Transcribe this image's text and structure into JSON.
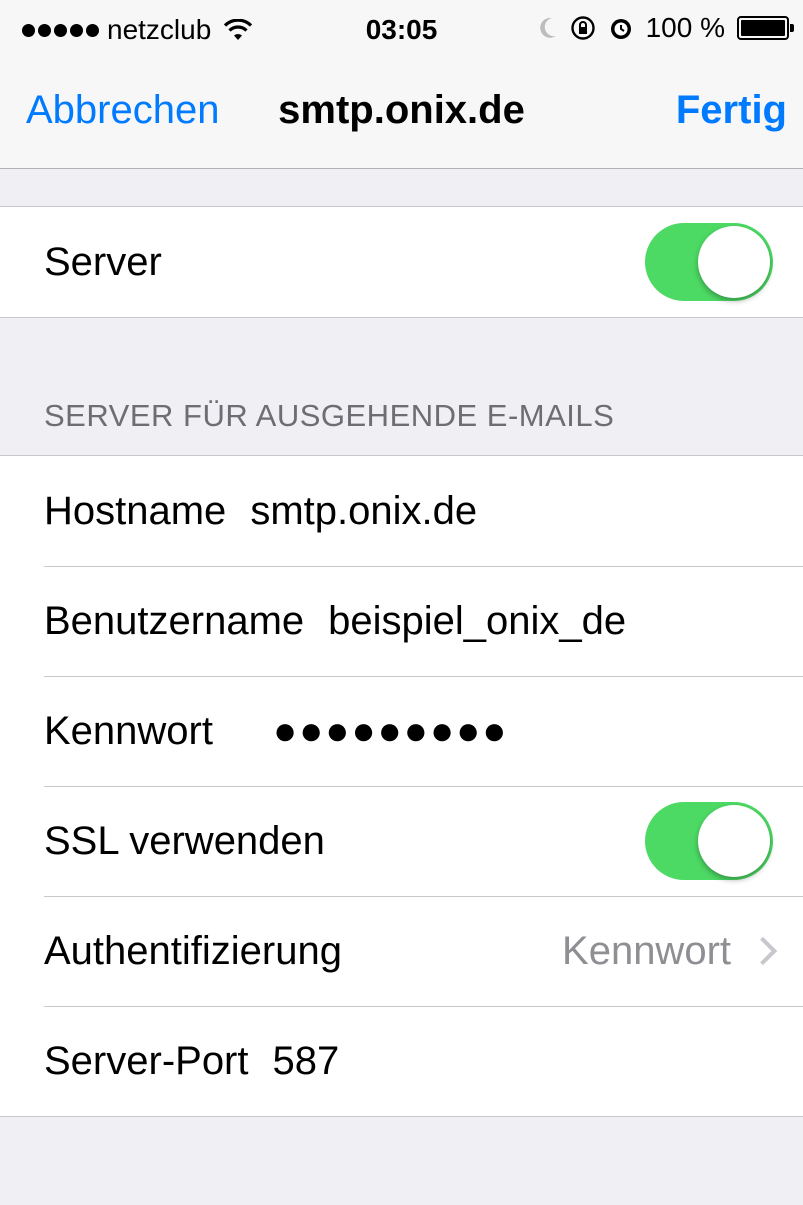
{
  "status_bar": {
    "signal_bars": 5,
    "carrier": "netzclub",
    "wifi_icon": "wifi-icon",
    "time": "03:05",
    "icons": [
      "moon-icon",
      "rotation-lock-icon",
      "alarm-icon"
    ],
    "battery_text": "100 %",
    "battery_level_percent": 100
  },
  "nav": {
    "cancel_label": "Abbrechen",
    "title": "smtp.onix.de",
    "done_label": "Fertig"
  },
  "server_toggle": {
    "label": "Server",
    "on": true
  },
  "section_header": "SERVER FÜR AUSGEHENDE E-MAILS",
  "fields": {
    "hostname": {
      "label": "Hostname",
      "value": "smtp.onix.de"
    },
    "username": {
      "label": "Benutzername",
      "value": "beispiel_onix_de"
    },
    "password": {
      "label": "Kennwort",
      "value": "●●●●●●●●●"
    },
    "ssl": {
      "label": "SSL verwenden",
      "on": true
    },
    "auth": {
      "label": "Authentifizierung",
      "value": "Kennwort"
    },
    "port": {
      "label": "Server-Port",
      "value": "587"
    }
  },
  "colors": {
    "accent": "#007aff",
    "toggle_on": "#4cd964",
    "background": "#efeff4"
  }
}
